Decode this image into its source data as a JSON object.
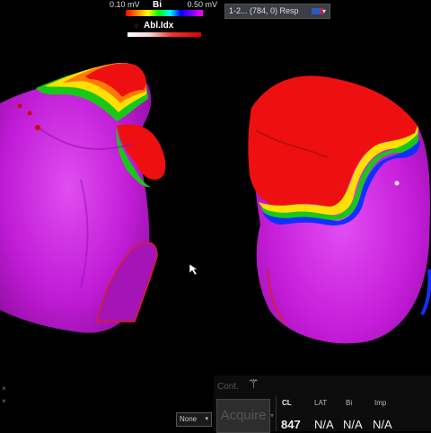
{
  "voltage_scale": {
    "min_label": "0.10 mV",
    "max_label": "0.50 mV",
    "title": "Bi"
  },
  "abl_index": {
    "title": "Abl.Idx"
  },
  "view_selector": {
    "value": "1-2... (784, 0) Resp"
  },
  "axis_markers": [
    "×",
    "×"
  ],
  "controls": {
    "cont_label": "Cont.",
    "acquire_label": "Acquire",
    "none_select": "None"
  },
  "readouts": {
    "headers": [
      "CL",
      "LAT",
      "Bi",
      "Imp"
    ],
    "values": [
      "847",
      "N/A",
      "N/A",
      "N/A"
    ]
  },
  "colors": {
    "tissue": "#cc22dd",
    "scar": "#e81010",
    "lesion_outline": "#d82020"
  }
}
